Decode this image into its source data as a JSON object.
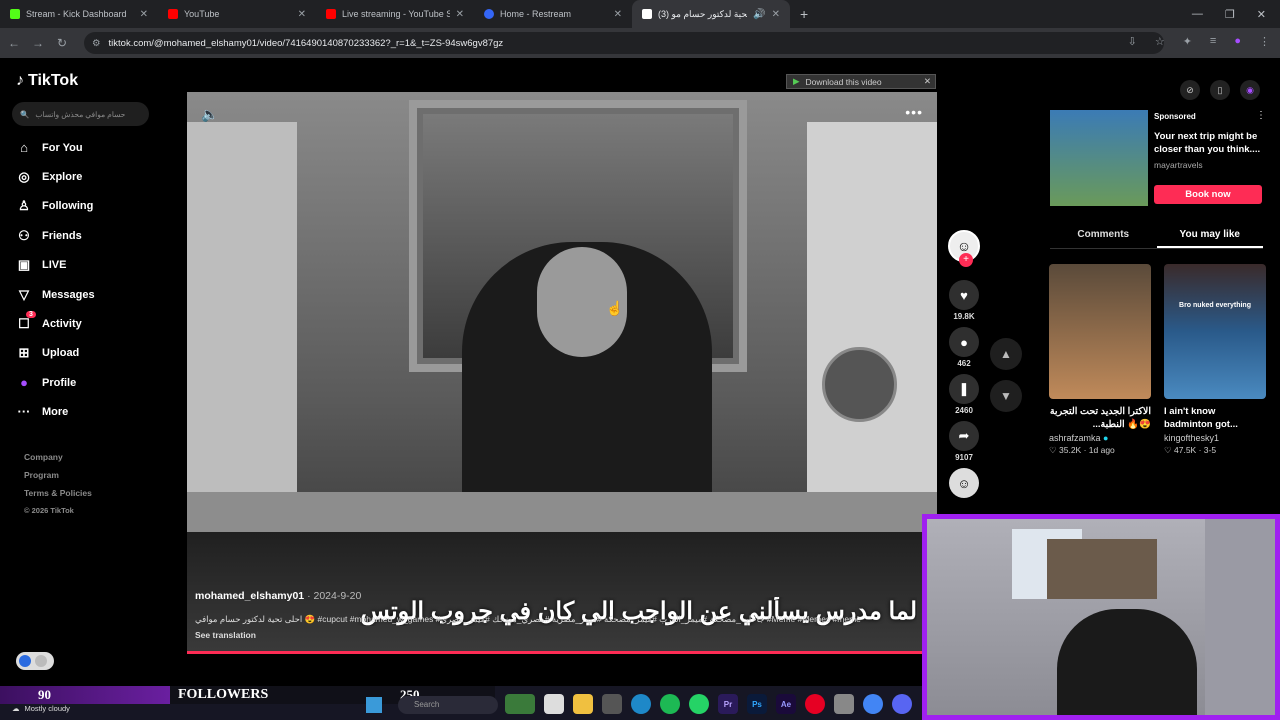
{
  "browser": {
    "tabs": [
      {
        "label": "Stream - Kick Dashboard",
        "color": "#53fc18"
      },
      {
        "label": "YouTube",
        "color": "#ff0000"
      },
      {
        "label": "Live streaming - YouTube Studio",
        "color": "#ff0000"
      },
      {
        "label": "Home - Restream",
        "color": "#3466f6"
      },
      {
        "label": "(3) احلى تحية لدكتور حسام مو",
        "color": "#ffffff"
      }
    ],
    "url": "tiktok.com/@mohamed_elshamy01/video/7416490140870233362?_r=1&_t=ZS-94sw6gv87gz"
  },
  "tiktok": {
    "logo": "TikTok",
    "search_placeholder": "حسام موافي محذش واتساب",
    "nav": [
      {
        "label": "For You",
        "icon": "home-icon"
      },
      {
        "label": "Explore",
        "icon": "compass-icon"
      },
      {
        "label": "Following",
        "icon": "following-icon"
      },
      {
        "label": "Friends",
        "icon": "friends-icon"
      },
      {
        "label": "LIVE",
        "icon": "live-icon"
      },
      {
        "label": "Messages",
        "icon": "messages-icon"
      },
      {
        "label": "Activity",
        "icon": "activity-icon",
        "badge": "3"
      },
      {
        "label": "Upload",
        "icon": "upload-icon"
      },
      {
        "label": "Profile",
        "icon": "profile-icon"
      },
      {
        "label": "More",
        "icon": "more-icon"
      }
    ],
    "footer": [
      "Company",
      "Program",
      "Terms & Policies",
      "© 2026 TikTok"
    ],
    "video": {
      "author": "mohamed_elshamy01",
      "date": "· 2024-9-20",
      "description": "احلى تحية لدكتور حسام موافي 😍 #cupcut #mohamed_w_games #جاحات_مضحكة #ميمز_العرب #ميمز_مضحكة #ميمز_مصرية #مصري_مضحك #ميمز_مصري #Meme #Memes #meme",
      "see_translation": "See translation",
      "subtitle": "لما مدرس يسألني عن الواجب الي كان في جروب الوتس",
      "progress": 0.98
    },
    "download_banner": "Download this video",
    "actions": {
      "likes": "19.8K",
      "comments": "462",
      "saves": "2460",
      "shares": "9107"
    },
    "ad": {
      "sponsored": "Sponsored",
      "title": "Your next trip might be closer than you think....",
      "brand": "mayartravels",
      "button": "Book now"
    },
    "tabs": {
      "comments": "Comments",
      "you_may_like": "You may like"
    },
    "cards": [
      {
        "caption": "",
        "title": "الاكترا الجديد تحت التجربة 😍🔥 النطبة...",
        "user": "ashrafzamka",
        "likes": "35.2K",
        "time": "1d ago"
      },
      {
        "caption": "Bro nuked everything",
        "title": "I ain't know badminton got...",
        "user": "kingofthesky1",
        "likes": "47.5K",
        "time": "3-5"
      }
    ]
  },
  "overlay": {
    "followers_count": "90",
    "followers_label": "FOLLOWERS",
    "goal": "250",
    "weather": "Mostly cloudy",
    "taskbar_search": "Search"
  }
}
